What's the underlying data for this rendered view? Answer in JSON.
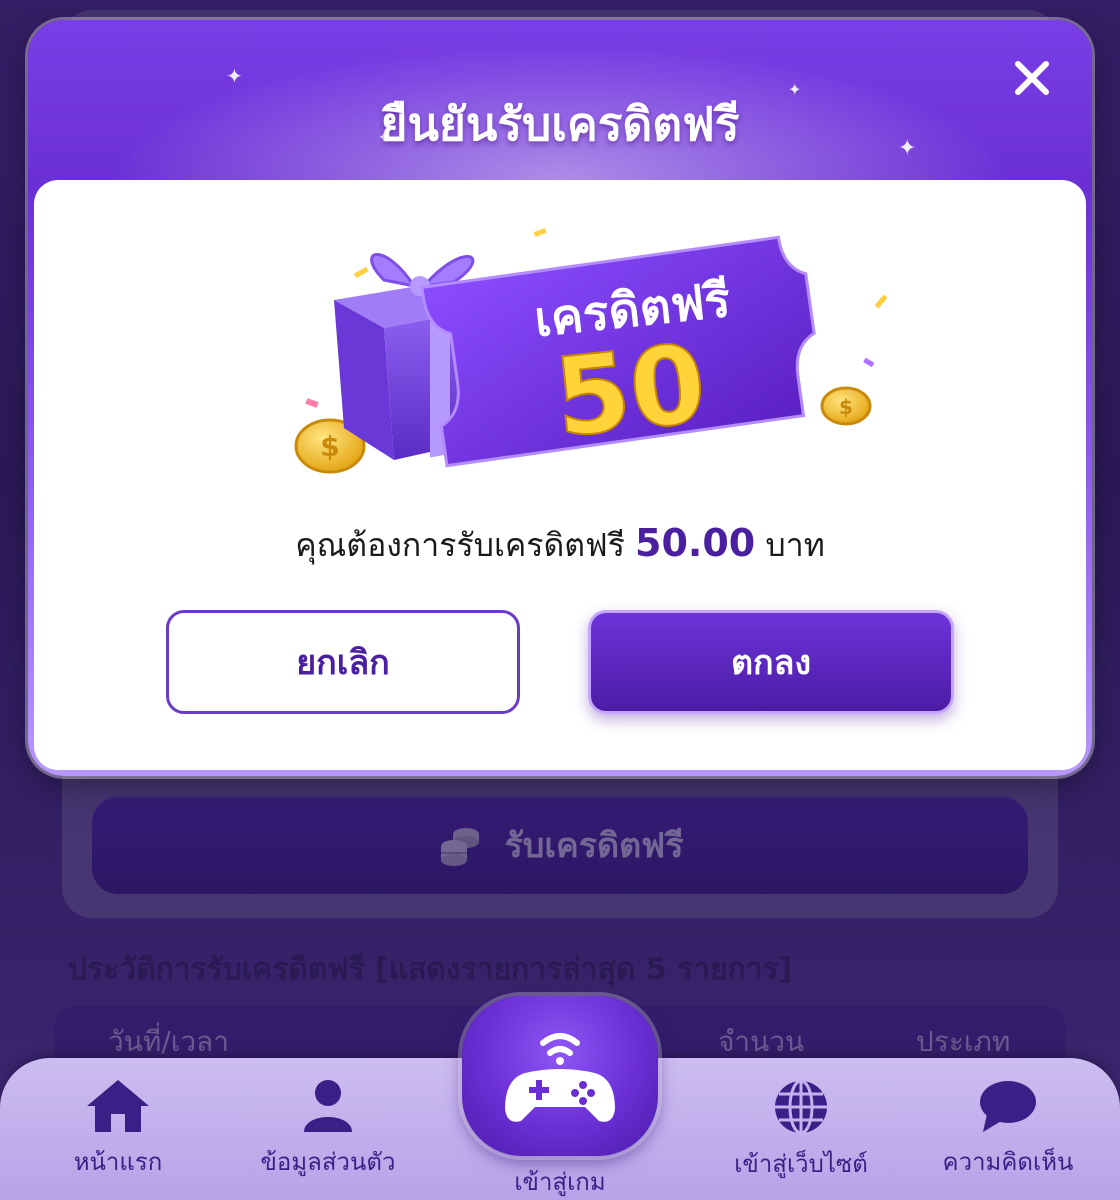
{
  "modal": {
    "title": "ยืนยันรับเครดิตฟรี",
    "ticket_title": "เครดิตฟรี",
    "ticket_amount": "50",
    "message_prefix": "คุณต้องการรับเครดิตฟรี",
    "message_amount": "50.00",
    "message_suffix": "บาท",
    "cancel_label": "ยกเลิก",
    "ok_label": "ตกลง",
    "close_icon": "close-icon"
  },
  "background": {
    "claim_button_label": "รับเครดิตฟรี",
    "history_title": "ประวัติการรับเครดิตฟรี [แสดงรายการล่าสุด 5 รายการ]",
    "table_headers": [
      "วันที่/เวลา",
      "จำนวน",
      "ประเภท"
    ]
  },
  "nav": {
    "items": [
      {
        "label": "หน้าแรก",
        "icon": "home-icon"
      },
      {
        "label": "ข้อมูลส่วนตัว",
        "icon": "user-icon"
      },
      {
        "label": "เข้าสู่เกม",
        "icon": "gamepad-icon"
      },
      {
        "label": "เข้าสู่เว็บไซต์",
        "icon": "globe-icon"
      },
      {
        "label": "ความคิดเห็น",
        "icon": "chat-icon"
      }
    ]
  },
  "colors": {
    "primary": "#6a2fd4",
    "gold": "#ffd43b",
    "nav_bg": "#c4b2ee"
  }
}
